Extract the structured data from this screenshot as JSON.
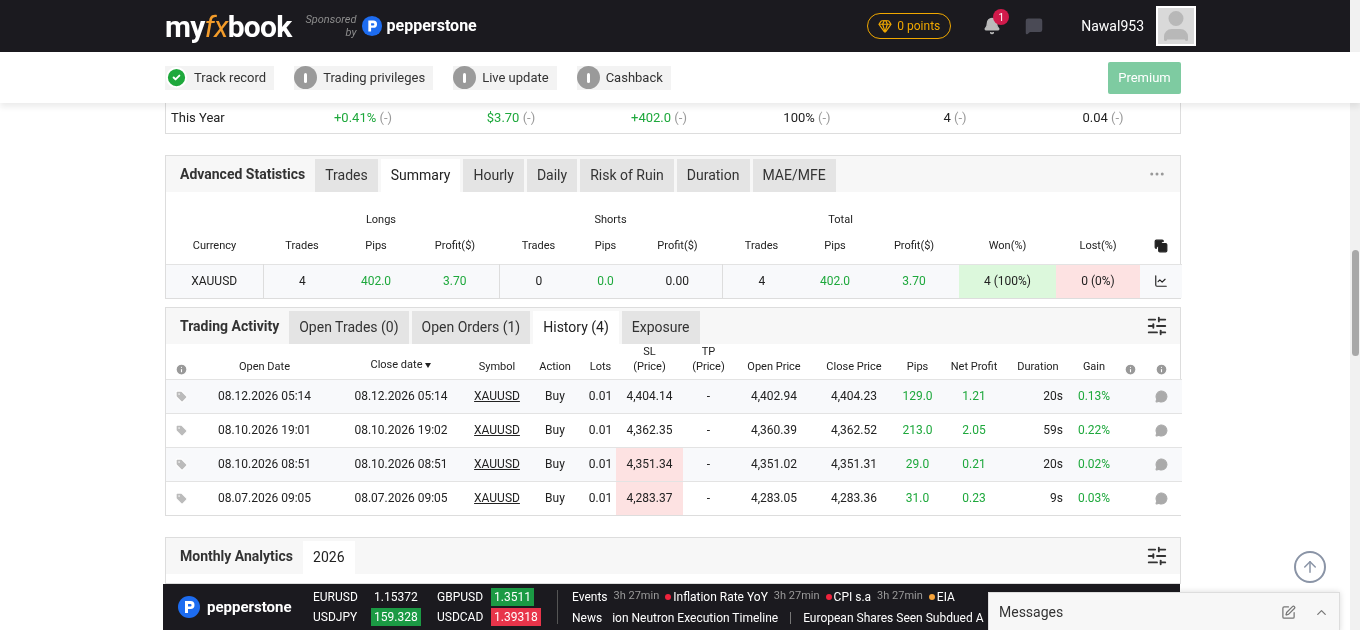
{
  "header": {
    "logo_parts": [
      {
        "text": "my",
        "accent": false
      },
      {
        "text": "fx",
        "accent": true
      },
      {
        "text": "book",
        "accent": false
      }
    ],
    "sponsor_lines": [
      "Sponsored",
      "by"
    ],
    "sponsor_brand": "pepperstone",
    "points": "0 points",
    "notification_count": "1",
    "username": "Nawal953"
  },
  "status_items": [
    {
      "label": "Track record",
      "verified": true
    },
    {
      "label": "Trading privileges",
      "verified": false
    },
    {
      "label": "Live update",
      "verified": false
    },
    {
      "label": "Cashback",
      "verified": false
    }
  ],
  "premium_button": "Premium",
  "year_row": {
    "label": "This Year",
    "cells": [
      {
        "value": "+0.41%",
        "change": "(-)",
        "positive": true
      },
      {
        "value": "$3.70",
        "change": "(-)",
        "positive": true
      },
      {
        "value": "+402.0",
        "change": "(-)",
        "positive": true
      },
      {
        "value": "100%",
        "change": "(-)",
        "positive": false
      },
      {
        "value": "4",
        "change": "(-)",
        "positive": false
      },
      {
        "value": "0.04",
        "change": "(-)",
        "positive": false
      }
    ]
  },
  "advanced_statistics": {
    "title": "Advanced Statistics",
    "tabs": [
      {
        "label": "Trades",
        "selected": false
      },
      {
        "label": "Summary",
        "selected": true
      },
      {
        "label": "Hourly",
        "selected": false
      },
      {
        "label": "Daily",
        "selected": false
      },
      {
        "label": "Risk of Ruin",
        "selected": false
      },
      {
        "label": "Duration",
        "selected": false
      },
      {
        "label": "MAE/MFE",
        "selected": false
      }
    ],
    "group_headers": [
      "Longs",
      "Shorts",
      "Total"
    ],
    "columns": [
      "Currency",
      "Trades",
      "Pips",
      "Profit($)",
      "Trades",
      "Pips",
      "Profit($)",
      "Trades",
      "Pips",
      "Profit($)",
      "Won(%)",
      "Lost(%)"
    ],
    "rows": [
      {
        "cells": [
          {
            "value": "XAUUSD",
            "kind": "plain"
          },
          {
            "value": "4",
            "kind": "plain"
          },
          {
            "value": "402.0",
            "kind": "gain"
          },
          {
            "value": "3.70",
            "kind": "gain"
          },
          {
            "value": "0",
            "kind": "plain"
          },
          {
            "value": "0.0",
            "kind": "gain"
          },
          {
            "value": "0.00",
            "kind": "plain"
          },
          {
            "value": "4",
            "kind": "plain"
          },
          {
            "value": "402.0",
            "kind": "gain"
          },
          {
            "value": "3.70",
            "kind": "gain"
          },
          {
            "value": "4 (100%)",
            "kind": "won"
          },
          {
            "value": "0 (0%)",
            "kind": "lost"
          }
        ]
      }
    ]
  },
  "trading_activity": {
    "title": "Trading Activity",
    "tabs": [
      {
        "label": "Open Trades (0)",
        "selected": false
      },
      {
        "label": "Open Orders (1)",
        "selected": false
      },
      {
        "label": "History (4)",
        "selected": true
      },
      {
        "label": "Exposure",
        "selected": false
      }
    ],
    "columns": [
      {
        "label": "Open Date",
        "sorted": false,
        "positive": false
      },
      {
        "label": "Close date",
        "sorted": true,
        "positive": false
      },
      {
        "label": "Symbol",
        "sorted": false,
        "positive": false
      },
      {
        "label": "Action",
        "sorted": false,
        "positive": false
      },
      {
        "label": "Lots",
        "sorted": false,
        "positive": false
      },
      {
        "label": "SL\n(Price)",
        "sorted": false,
        "positive": false
      },
      {
        "label": "TP\n(Price)",
        "sorted": false,
        "positive": false
      },
      {
        "label": "Open Price",
        "sorted": false,
        "positive": false
      },
      {
        "label": "Close Price",
        "sorted": false,
        "positive": false
      },
      {
        "label": "Pips",
        "sorted": false,
        "positive": true
      },
      {
        "label": "Net Profit",
        "sorted": false,
        "positive": true
      },
      {
        "label": "Duration",
        "sorted": false,
        "positive": false
      },
      {
        "label": "Gain",
        "sorted": false,
        "positive": true
      }
    ],
    "rows": [
      {
        "cells": [
          "08.12.2026 05:14",
          "08.12.2026 05:14",
          "XAUUSD",
          "Buy",
          "0.01",
          "4,404.14",
          "-",
          "4,402.94",
          "4,404.23",
          "129.0",
          "1.21",
          "20s",
          "0.13%"
        ],
        "sl_hit": false
      },
      {
        "cells": [
          "08.10.2026 19:01",
          "08.10.2026 19:02",
          "XAUUSD",
          "Buy",
          "0.01",
          "4,362.35",
          "-",
          "4,360.39",
          "4,362.52",
          "213.0",
          "2.05",
          "59s",
          "0.22%"
        ],
        "sl_hit": false
      },
      {
        "cells": [
          "08.10.2026 08:51",
          "08.10.2026 08:51",
          "XAUUSD",
          "Buy",
          "0.01",
          "4,351.34",
          "-",
          "4,351.02",
          "4,351.31",
          "29.0",
          "0.21",
          "20s",
          "0.02%"
        ],
        "sl_hit": true
      },
      {
        "cells": [
          "08.07.2026 09:05",
          "08.07.2026 09:05",
          "XAUUSD",
          "Buy",
          "0.01",
          "4,283.37",
          "-",
          "4,283.05",
          "4,283.36",
          "31.0",
          "0.23",
          "9s",
          "0.03%"
        ],
        "sl_hit": true
      }
    ]
  },
  "monthly_analytics": {
    "title": "Monthly Analytics",
    "tabs": [
      {
        "label": "2026",
        "selected": true
      }
    ]
  },
  "ticker": {
    "brand": "pepperstone",
    "quotes": [
      {
        "symbol": "EURUSD",
        "price": "1.15372",
        "kind": "steady"
      },
      {
        "symbol": "GBPUSD",
        "price": "1.3511",
        "kind": "rising"
      },
      {
        "symbol": "USDJPY",
        "price": "159.328",
        "kind": "rising"
      },
      {
        "symbol": "USDCAD",
        "price": "1.39318",
        "kind": "falling"
      }
    ],
    "events_label": "Events",
    "events": [
      {
        "time": "3h 27min",
        "title": "Inflation Rate YoY",
        "color": "#ef233c"
      },
      {
        "time": "3h 27min",
        "title": "CPI s.a",
        "color": "#ef233c"
      },
      {
        "time": "3h 27min",
        "title": "EIA",
        "color": "#f4a23a"
      }
    ],
    "news_label": "News",
    "news": [
      "ion Neutron Execution Timeline",
      "European Shares Seen Subdued A"
    ]
  },
  "messages": {
    "title": "Messages"
  }
}
